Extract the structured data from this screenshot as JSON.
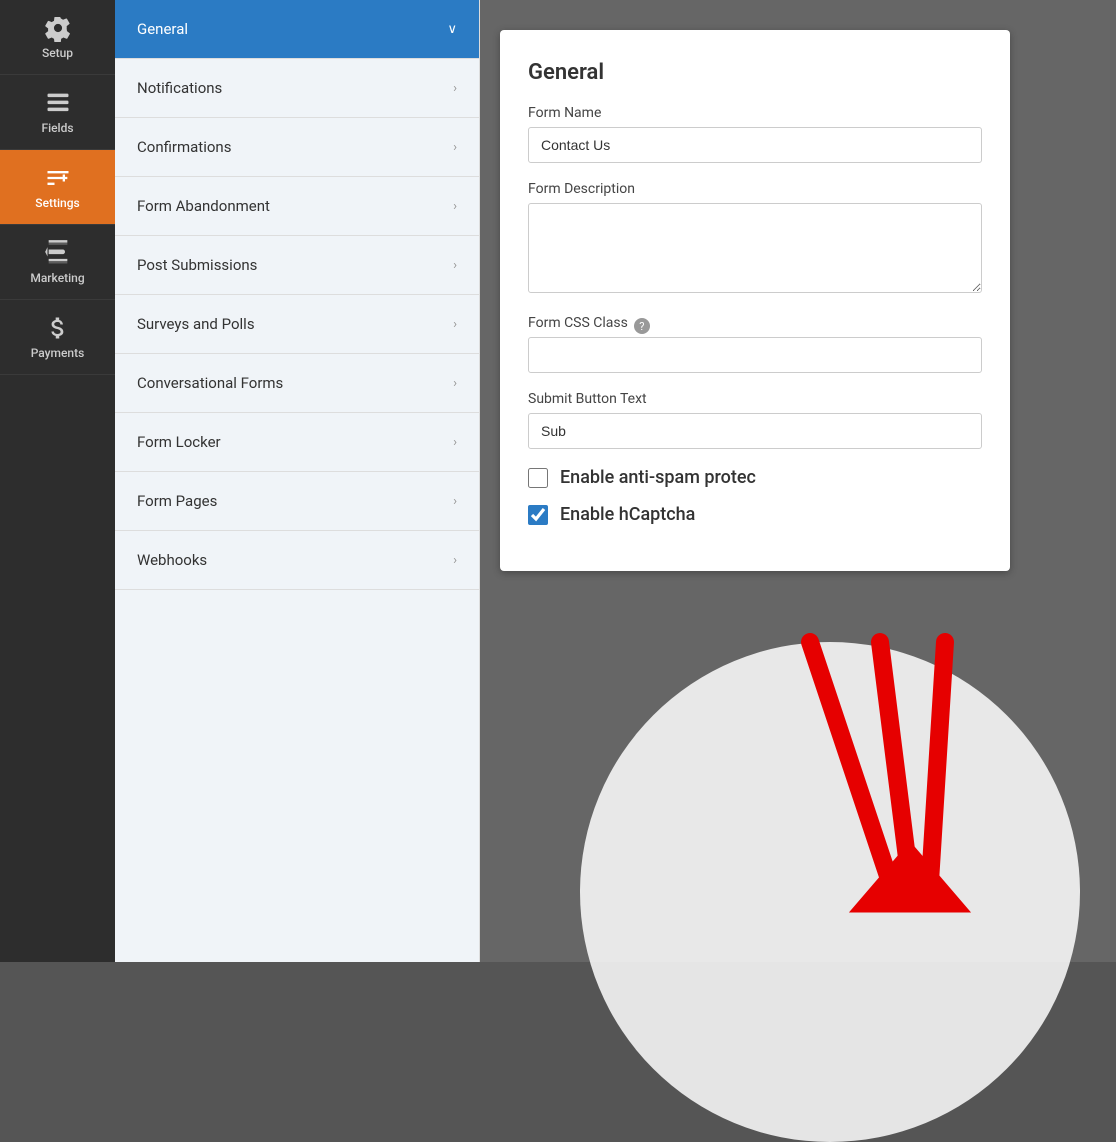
{
  "sidebar": {
    "items": [
      {
        "id": "setup",
        "label": "Setup",
        "icon": "gear"
      },
      {
        "id": "fields",
        "label": "Fields",
        "icon": "fields"
      },
      {
        "id": "settings",
        "label": "Settings",
        "icon": "settings",
        "active": true
      },
      {
        "id": "marketing",
        "label": "Marketing",
        "icon": "marketing"
      },
      {
        "id": "payments",
        "label": "Payments",
        "icon": "payments"
      }
    ]
  },
  "menu": {
    "items": [
      {
        "id": "general",
        "label": "General",
        "active": true,
        "chevron": "∨"
      },
      {
        "id": "notifications",
        "label": "Notifications",
        "chevron": "›"
      },
      {
        "id": "confirmations",
        "label": "Confirmations",
        "chevron": "›"
      },
      {
        "id": "form-abandonment",
        "label": "Form Abandonment",
        "chevron": "›"
      },
      {
        "id": "post-submissions",
        "label": "Post Submissions",
        "chevron": "›"
      },
      {
        "id": "surveys-polls",
        "label": "Surveys and Polls",
        "chevron": "›"
      },
      {
        "id": "conversational-forms",
        "label": "Conversational Forms",
        "chevron": "›"
      },
      {
        "id": "form-locker",
        "label": "Form Locker",
        "chevron": "›"
      },
      {
        "id": "form-pages",
        "label": "Form Pages",
        "chevron": "›"
      },
      {
        "id": "webhooks",
        "label": "Webhooks",
        "chevron": "›"
      }
    ]
  },
  "panel": {
    "title": "General",
    "form_name_label": "Form Name",
    "form_name_value": "Contact Us",
    "form_description_label": "Form Description",
    "form_description_value": "",
    "form_css_class_label": "Form CSS Class",
    "form_css_class_value": "",
    "help_icon_text": "?",
    "submit_button_label": "Submit Button Text",
    "submit_button_value": "Sub",
    "anti_spam_label": "Enable anti-spam protec",
    "hcaptcha_label": "Enable hCaptcha"
  }
}
